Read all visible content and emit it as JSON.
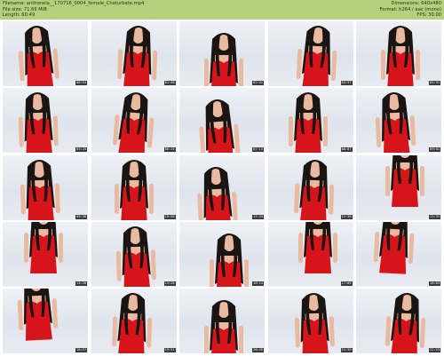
{
  "header": {
    "filename": "Filename: anthonela__170716_0004_female_Chaturbate.mp4",
    "filesize": "File size: 71.66 MiB",
    "length": "Length: 60:49",
    "dimensions": "Dimensions: 640x480",
    "format": "Format: h264 / aac (mono)",
    "fps": "FPS: 30.00"
  },
  "thumbnails": [
    {
      "time": "00:54"
    },
    {
      "time": "01:48"
    },
    {
      "time": "02:42"
    },
    {
      "time": "03:37"
    },
    {
      "time": "04:31"
    },
    {
      "time": "05:25"
    },
    {
      "time": "06:19"
    },
    {
      "time": "07:13"
    },
    {
      "time": "08:07"
    },
    {
      "time": "09:01"
    },
    {
      "time": "09:56"
    },
    {
      "time": "10:50"
    },
    {
      "time": "11:44"
    },
    {
      "time": "12:38"
    },
    {
      "time": "13:32"
    },
    {
      "time": "14:26"
    },
    {
      "time": "15:20"
    },
    {
      "time": "16:14"
    },
    {
      "time": "17:09"
    },
    {
      "time": "18:03"
    },
    {
      "time": "18:57"
    },
    {
      "time": "19:51"
    },
    {
      "time": "20:45"
    },
    {
      "time": "21:39"
    },
    {
      "time": "22:33"
    }
  ],
  "colors": {
    "header_bg": "#b5d07a",
    "dress": "#d8141b",
    "hair": "#1a1412",
    "skin": "#e9b9a0",
    "background": "#e6e9ef"
  }
}
